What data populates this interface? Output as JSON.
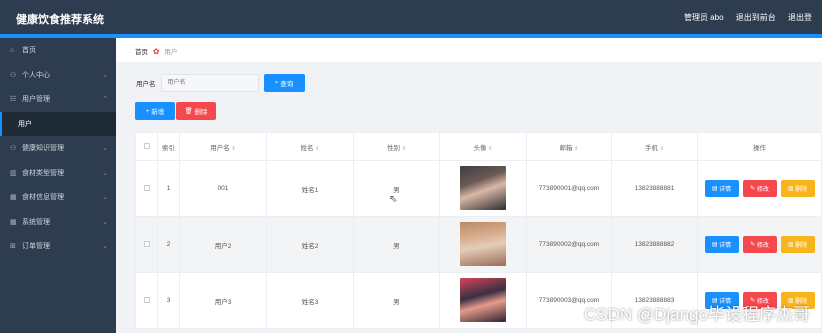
{
  "app": {
    "title": "健康饮食推荐系统",
    "admin_label": "管理员 abo",
    "backend_link": "退出到前台",
    "logout_link": "退出登"
  },
  "sidebar": {
    "items": [
      {
        "label": "首页",
        "icon": "home-icon"
      },
      {
        "label": "个人中心",
        "icon": "user-icon"
      },
      {
        "label": "用户管理",
        "icon": "list-icon"
      },
      {
        "label": "用户",
        "icon": ""
      },
      {
        "label": "健康知识管理",
        "icon": "user-icon"
      },
      {
        "label": "食材类型管理",
        "icon": "chart-icon"
      },
      {
        "label": "食材信息管理",
        "icon": "table-icon"
      },
      {
        "label": "系统管理",
        "icon": "table-icon"
      },
      {
        "label": "订单管理",
        "icon": "grid-icon"
      }
    ]
  },
  "breadcrumb": {
    "home": "首页",
    "current": "用户"
  },
  "search": {
    "label": "用户名",
    "placeholder": "用户名",
    "button": "查询"
  },
  "actions": {
    "add": "新增",
    "delete": "删除"
  },
  "table": {
    "headers": {
      "index": "索引",
      "username": "用户名",
      "name": "姓名",
      "gender": "性别",
      "avatar": "头像",
      "email": "邮箱",
      "phone": "手机",
      "ops": "操作"
    },
    "rows": [
      {
        "index": "1",
        "username": "001",
        "name": "姓名1",
        "gender": "男",
        "email": "773890001@qq.com",
        "phone": "13823888881"
      },
      {
        "index": "2",
        "username": "用户2",
        "name": "姓名2",
        "gender": "男",
        "email": "773890002@qq.com",
        "phone": "13823888882"
      },
      {
        "index": "3",
        "username": "用户3",
        "name": "姓名3",
        "gender": "男",
        "email": "773890003@qq.com",
        "phone": "13823888883"
      }
    ],
    "op_labels": {
      "detail": "详情",
      "edit": "修改",
      "delete": "删除"
    }
  },
  "watermark": "CSDN @Django毕设程序杰哥",
  "colors": {
    "primary": "#1890ff",
    "danger": "#f5484e",
    "warning": "#f8b51b",
    "sidebar_bg": "#2e3c4f"
  }
}
